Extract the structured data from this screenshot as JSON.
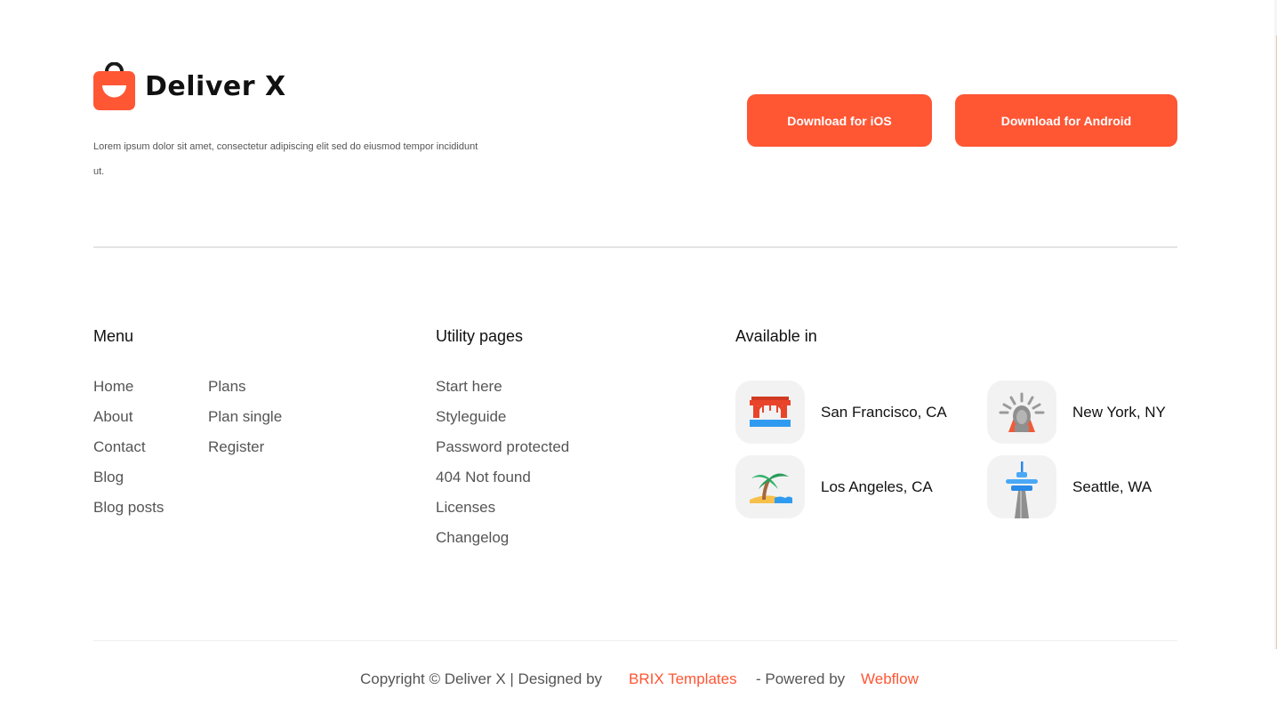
{
  "brand": {
    "name": "Deliver X",
    "accent_color": "#ff5634",
    "tagline": "Lorem ipsum dolor sit amet, consectetur adipiscing elit sed do eiusmod tempor incididunt ut."
  },
  "downloads": {
    "ios_label": "Download for iOS",
    "android_label": "Download for Android"
  },
  "menu": {
    "title": "Menu",
    "col1": [
      "Home",
      "About",
      "Contact",
      "Blog",
      "Blog posts"
    ],
    "col2": [
      "Plans",
      "Plan single",
      "Register"
    ]
  },
  "utility": {
    "title": "Utility pages",
    "items": [
      "Start here",
      "Styleguide",
      "Password protected",
      "404 Not found",
      "Licenses",
      "Changelog"
    ]
  },
  "available": {
    "title": "Available in",
    "cities": [
      {
        "name": "San Francisco, CA",
        "icon": "golden-gate-bridge-icon"
      },
      {
        "name": "New York, NY",
        "icon": "statue-of-liberty-icon"
      },
      {
        "name": "Los Angeles, CA",
        "icon": "palm-tree-beach-icon"
      },
      {
        "name": "Seattle, WA",
        "icon": "space-needle-icon"
      }
    ]
  },
  "footer": {
    "copyright": "Copyright © Deliver X | Designed by",
    "designer": "BRIX Templates",
    "powered": "- Powered by",
    "platform": "Webflow"
  }
}
